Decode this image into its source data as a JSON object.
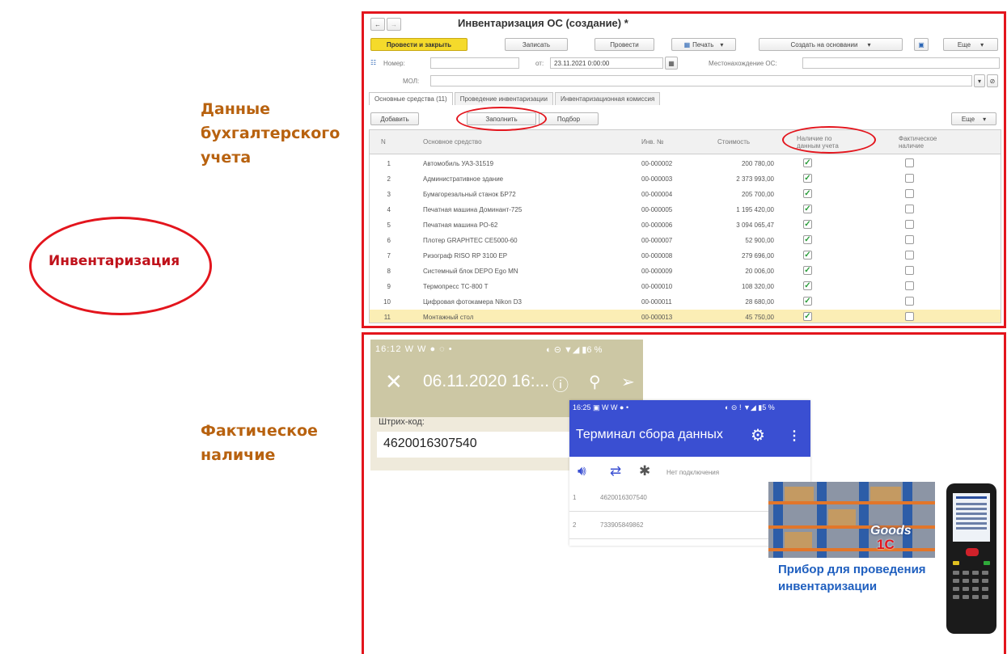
{
  "labels": {
    "accounting": "Данные\nбухгалтерского\nучета",
    "center": "Инвентаризация",
    "actual": "Фактическое\nналичие"
  },
  "colors": {
    "frame": "#e3151d",
    "label": "#b8620f",
    "accent_yellow": "#f5da2b",
    "phone_blue": "#3a4fd2"
  },
  "onec": {
    "back_icon": "arrow-left-icon",
    "forward_icon": "arrow-right-icon",
    "title": "Инвентаризация ОС (создание) *",
    "toolbar": {
      "post_close": "Провести и закрыть",
      "save": "Записать",
      "post": "Провести",
      "print": "Печать",
      "create_based": "Создать на основании",
      "more": "Еще"
    },
    "form": {
      "number_label": "Номер:",
      "number_value": "",
      "from_label": "от:",
      "date_value": "23.11.2021  0:00:00",
      "location_label": "Местонахождение ОС:",
      "location_value": "",
      "mol_label": "МОЛ:",
      "mol_value": ""
    },
    "tabs": [
      "Основные средства (11)",
      "Проведение инвентаризации",
      "Инвентаризационная комиссия"
    ],
    "table_toolbar": {
      "add": "Добавить",
      "fill": "Заполнить",
      "select": "Подбор",
      "more": "Еще"
    },
    "columns": {
      "n": "N",
      "asset": "Основное средство",
      "inv": "Инв. №",
      "cost": "Стоимость",
      "book": "Наличие по\nданным учета",
      "actual": "Фактическое\nналичие"
    },
    "rows": [
      {
        "n": "1",
        "name": "Автомобиль УАЗ-31519",
        "inv": "00-000002",
        "cost": "200 780,00",
        "book": true,
        "actual": false
      },
      {
        "n": "2",
        "name": "Административное здание",
        "inv": "00-000003",
        "cost": "2 373 993,00",
        "book": true,
        "actual": false
      },
      {
        "n": "3",
        "name": "Бумагорезальный станок БР72",
        "inv": "00-000004",
        "cost": "205 700,00",
        "book": true,
        "actual": false
      },
      {
        "n": "4",
        "name": "Печатная машина Доминант-725",
        "inv": "00-000005",
        "cost": "1 195 420,00",
        "book": true,
        "actual": false
      },
      {
        "n": "5",
        "name": "Печатная машина РО-62",
        "inv": "00-000006",
        "cost": "3 094 065,47",
        "book": true,
        "actual": false
      },
      {
        "n": "6",
        "name": "Плотер GRAPHTEC CE5000-60",
        "inv": "00-000007",
        "cost": "52 900,00",
        "book": true,
        "actual": false
      },
      {
        "n": "7",
        "name": "Ризограф RISO RP 3100 EP",
        "inv": "00-000008",
        "cost": "279 696,00",
        "book": true,
        "actual": false
      },
      {
        "n": "8",
        "name": "Системный блок DEPO Ego MN",
        "inv": "00-000009",
        "cost": "20 006,00",
        "book": true,
        "actual": false
      },
      {
        "n": "9",
        "name": "Термопресс ТС-800 Т",
        "inv": "00-000010",
        "cost": "108 320,00",
        "book": true,
        "actual": false
      },
      {
        "n": "10",
        "name": "Цифровая фотокамера Nikon D3",
        "inv": "00-000011",
        "cost": "28 680,00",
        "book": true,
        "actual": false
      },
      {
        "n": "11",
        "name": "Монтажный стол",
        "inv": "00-000013",
        "cost": "45 750,00",
        "book": true,
        "actual": false
      }
    ]
  },
  "phone1": {
    "status_time": "16:12",
    "status_icons": "W W ● ◌ •",
    "status_right": "◐ ⊝ ▼◢ ▮6 %",
    "date": "06.11.2020 16:...",
    "barcode_label": "Штрих-код:",
    "barcode_value": "4620016307540"
  },
  "phone2": {
    "status_time": "16:25",
    "status_icons": "▣ W W ● •",
    "status_right": "◐ ⊝ ! ▼◢ ▮5 %",
    "title": "Терминал сбора данных",
    "no_connection": "Нет подключения",
    "rows": [
      {
        "n": "1",
        "code": "4620016307540"
      },
      {
        "n": "2",
        "code": "733905849862"
      }
    ]
  },
  "device": {
    "logo": "Goods",
    "logo_brand": "1C",
    "caption": "Прибор для проведения\nинвентаризации"
  }
}
